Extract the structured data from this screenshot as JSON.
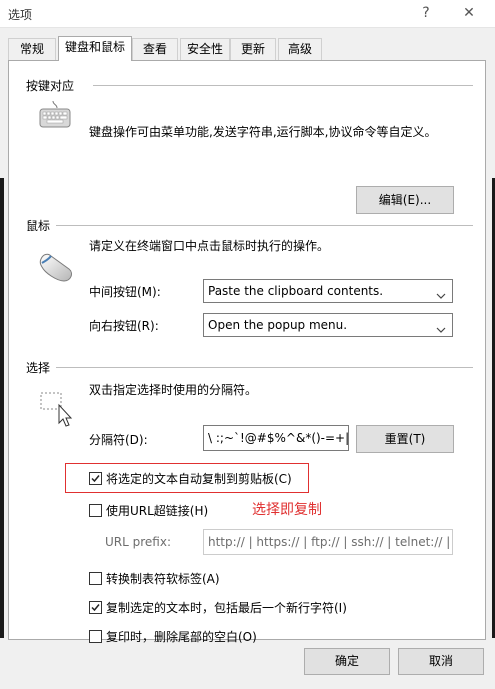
{
  "window": {
    "title": "选项",
    "help_glyph": "?",
    "close_glyph": "✕"
  },
  "tabs": [
    {
      "label": "常规"
    },
    {
      "label": "键盘和鼠标"
    },
    {
      "label": "查看"
    },
    {
      "label": "安全性"
    },
    {
      "label": "更新"
    },
    {
      "label": "高级"
    }
  ],
  "keymap": {
    "title": "按键对应",
    "description": "键盘操作可由菜单功能,发送字符串,运行脚本,协议命令等自定义。",
    "edit_label": "编辑(E)..."
  },
  "mouse": {
    "title": "鼠标",
    "description": "请定义在终端窗口中点击鼠标时执行的操作。",
    "middle_label": "中间按钮(M):",
    "middle_value": "Paste the clipboard contents.",
    "right_label": "向右按钮(R):",
    "right_value": "Open the popup menu."
  },
  "selection": {
    "title": "选择",
    "description": "双击指定选择时使用的分隔符。",
    "delimiter_label": "分隔符(D):",
    "delimiter_value": "\\ :;~`!@#$%^&*()-=+|[]{}",
    "reset_label": "重置(T)",
    "auto_copy_label": "将选定的文本自动复制到剪贴板(C)",
    "auto_copy_checked": true,
    "annotation": "选择即复制",
    "url_label": "使用URL超链接(H)",
    "url_checked": false,
    "url_prefix_label": "URL prefix:",
    "url_prefix_value": "http:// | https:// | ftp:// | ssh:// | telnet:// |",
    "tab_label": "转换制表符软标签(A)",
    "tab_checked": false,
    "copy_newline_label": "复制选定的文本时，包括最后一个新行字符(I)",
    "copy_newline_checked": true,
    "trim_label": "复印时，删除尾部的空白(O)",
    "trim_checked": false
  },
  "footer": {
    "ok_label": "确定",
    "cancel_label": "取消"
  },
  "colors": {
    "annotation": "#e03030",
    "button_face": "#e1e1e1",
    "dialog_bg": "#f0f0f0"
  }
}
